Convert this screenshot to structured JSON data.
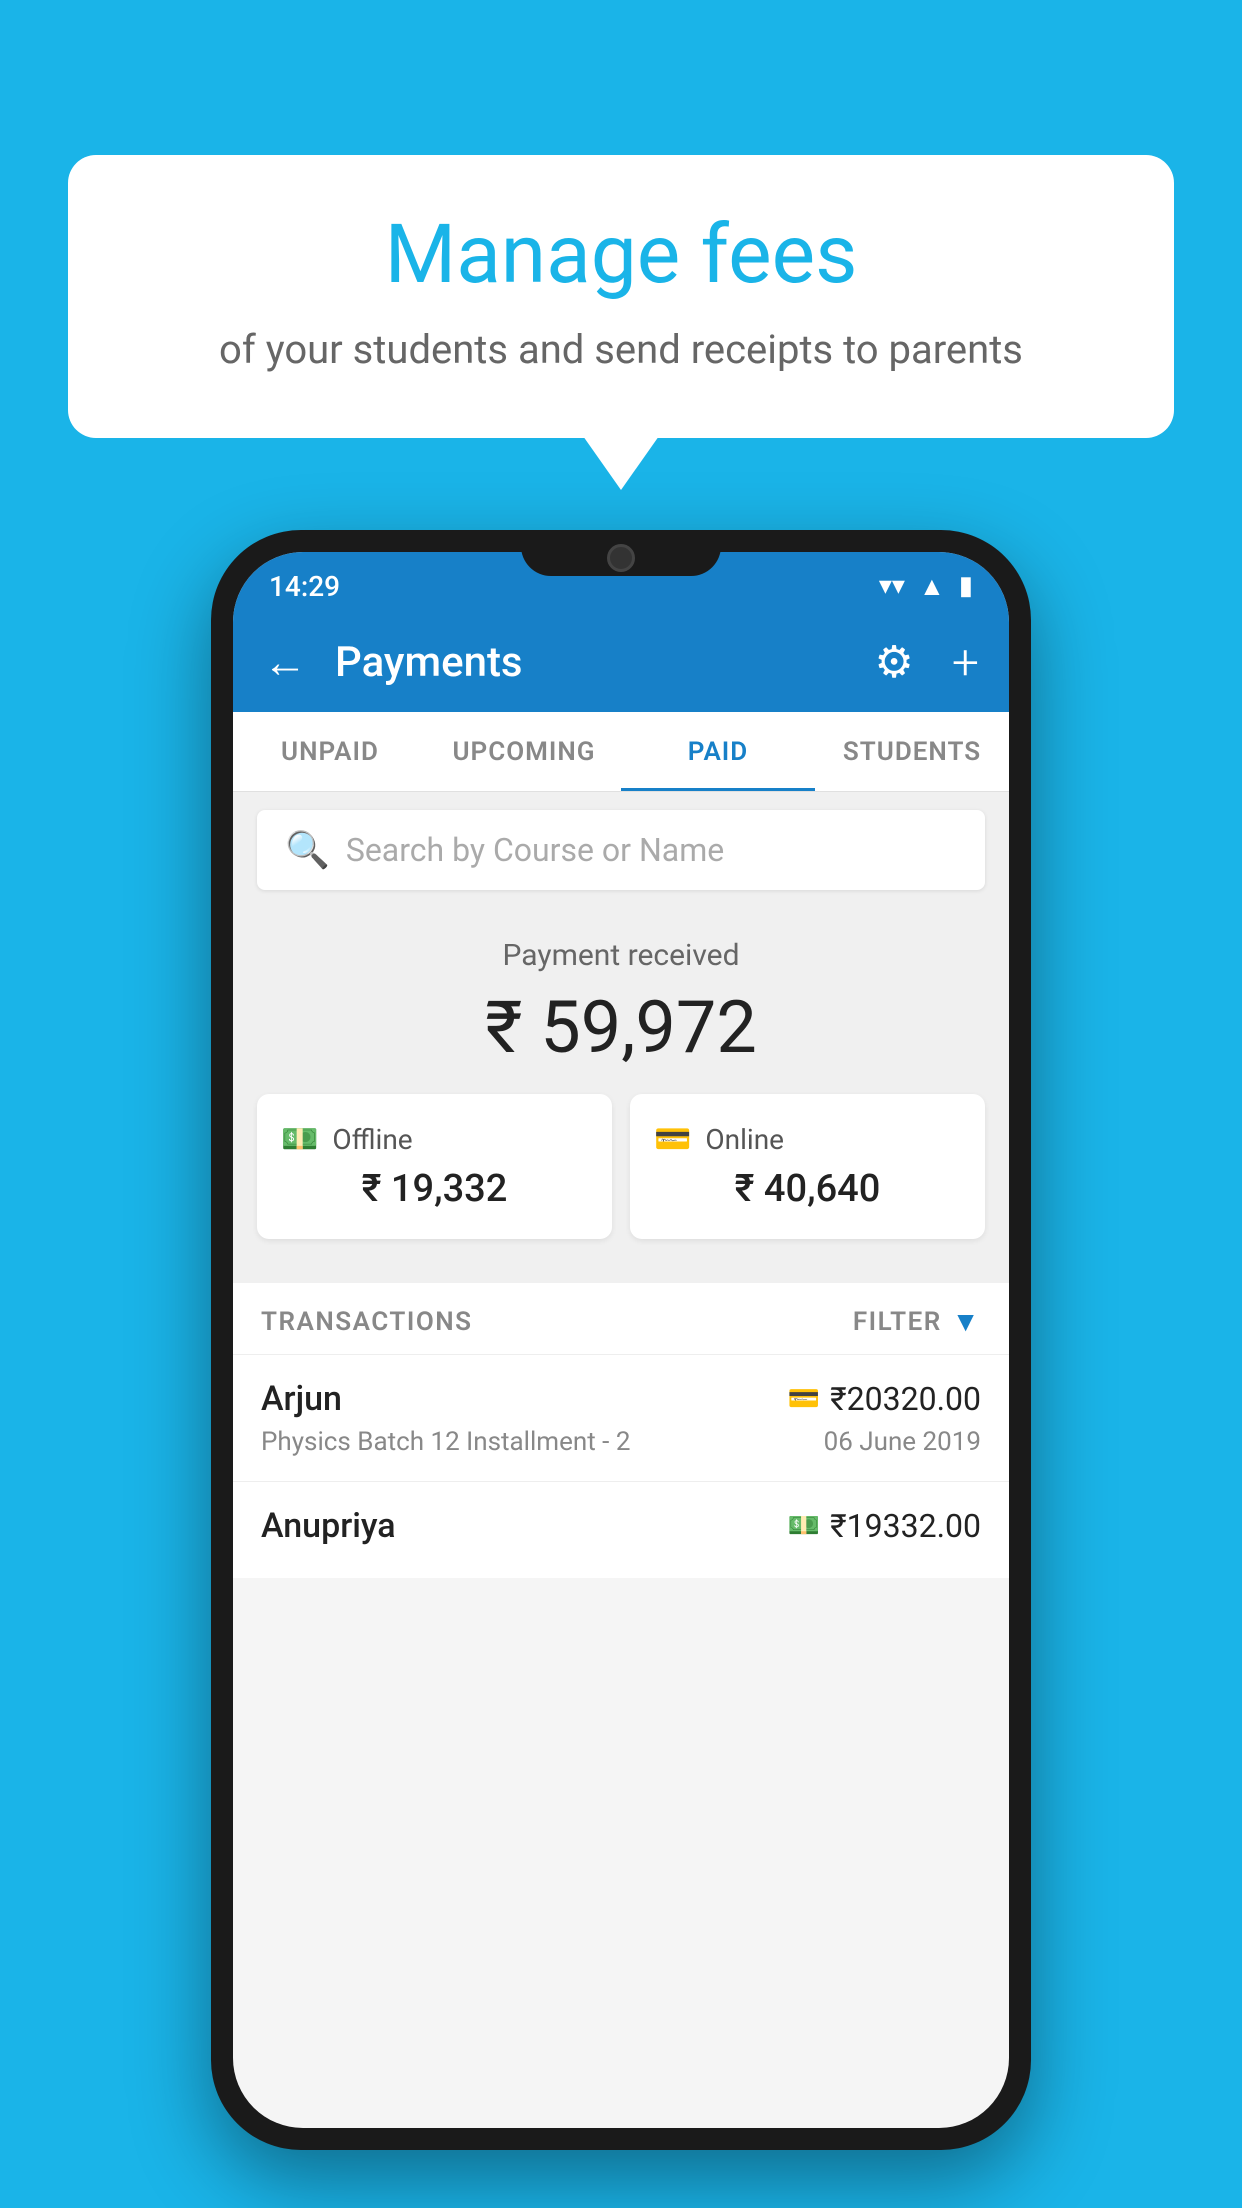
{
  "background_color": "#1ab4e8",
  "bubble": {
    "title": "Manage fees",
    "subtitle": "of your students and send receipts to parents"
  },
  "status_bar": {
    "time": "14:29",
    "wifi": "▼",
    "signal": "▲",
    "battery": "▮"
  },
  "header": {
    "title": "Payments",
    "back_label": "←",
    "gear_label": "⚙",
    "plus_label": "+"
  },
  "tabs": [
    {
      "id": "unpaid",
      "label": "UNPAID",
      "active": false
    },
    {
      "id": "upcoming",
      "label": "UPCOMING",
      "active": false
    },
    {
      "id": "paid",
      "label": "PAID",
      "active": true
    },
    {
      "id": "students",
      "label": "STUDENTS",
      "active": false
    }
  ],
  "search": {
    "placeholder": "Search by Course or Name"
  },
  "payment_summary": {
    "received_label": "Payment received",
    "total_amount": "₹ 59,972",
    "offline": {
      "label": "Offline",
      "amount": "₹ 19,332"
    },
    "online": {
      "label": "Online",
      "amount": "₹ 40,640"
    }
  },
  "transactions": {
    "header_label": "TRANSACTIONS",
    "filter_label": "FILTER",
    "rows": [
      {
        "name": "Arjun",
        "detail": "Physics Batch 12 Installment - 2",
        "amount": "₹20320.00",
        "date": "06 June 2019",
        "payment_type": "card"
      },
      {
        "name": "Anupriya",
        "detail": "",
        "amount": "₹19332.00",
        "date": "",
        "payment_type": "cash"
      }
    ]
  }
}
